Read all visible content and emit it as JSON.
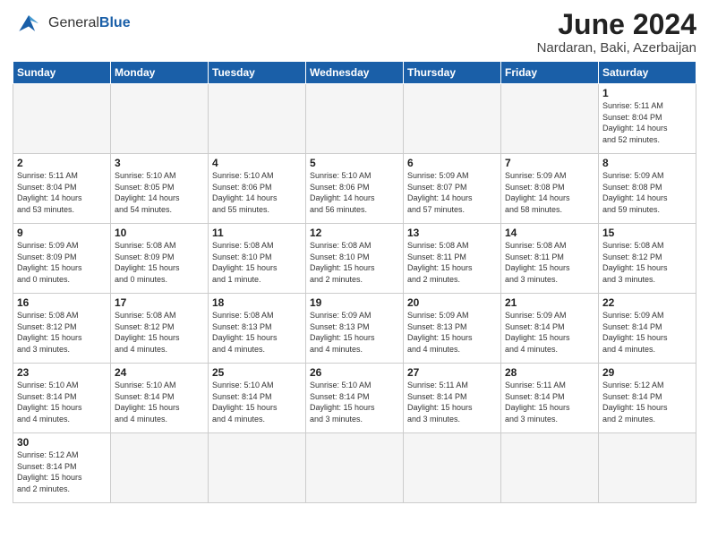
{
  "logo": {
    "general": "General",
    "blue": "Blue"
  },
  "header": {
    "title": "June 2024",
    "subtitle": "Nardaran, Baki, Azerbaijan"
  },
  "weekdays": [
    "Sunday",
    "Monday",
    "Tuesday",
    "Wednesday",
    "Thursday",
    "Friday",
    "Saturday"
  ],
  "days": [
    {
      "num": "",
      "info": "",
      "empty": true
    },
    {
      "num": "",
      "info": "",
      "empty": true
    },
    {
      "num": "",
      "info": "",
      "empty": true
    },
    {
      "num": "",
      "info": "",
      "empty": true
    },
    {
      "num": "",
      "info": "",
      "empty": true
    },
    {
      "num": "",
      "info": "",
      "empty": true
    },
    {
      "num": "1",
      "info": "Sunrise: 5:11 AM\nSunset: 8:04 PM\nDaylight: 14 hours\nand 52 minutes.",
      "empty": false
    },
    {
      "num": "2",
      "info": "Sunrise: 5:11 AM\nSunset: 8:04 PM\nDaylight: 14 hours\nand 53 minutes.",
      "empty": false
    },
    {
      "num": "3",
      "info": "Sunrise: 5:10 AM\nSunset: 8:05 PM\nDaylight: 14 hours\nand 54 minutes.",
      "empty": false
    },
    {
      "num": "4",
      "info": "Sunrise: 5:10 AM\nSunset: 8:06 PM\nDaylight: 14 hours\nand 55 minutes.",
      "empty": false
    },
    {
      "num": "5",
      "info": "Sunrise: 5:10 AM\nSunset: 8:06 PM\nDaylight: 14 hours\nand 56 minutes.",
      "empty": false
    },
    {
      "num": "6",
      "info": "Sunrise: 5:09 AM\nSunset: 8:07 PM\nDaylight: 14 hours\nand 57 minutes.",
      "empty": false
    },
    {
      "num": "7",
      "info": "Sunrise: 5:09 AM\nSunset: 8:08 PM\nDaylight: 14 hours\nand 58 minutes.",
      "empty": false
    },
    {
      "num": "8",
      "info": "Sunrise: 5:09 AM\nSunset: 8:08 PM\nDaylight: 14 hours\nand 59 minutes.",
      "empty": false
    },
    {
      "num": "9",
      "info": "Sunrise: 5:09 AM\nSunset: 8:09 PM\nDaylight: 15 hours\nand 0 minutes.",
      "empty": false
    },
    {
      "num": "10",
      "info": "Sunrise: 5:08 AM\nSunset: 8:09 PM\nDaylight: 15 hours\nand 0 minutes.",
      "empty": false
    },
    {
      "num": "11",
      "info": "Sunrise: 5:08 AM\nSunset: 8:10 PM\nDaylight: 15 hours\nand 1 minute.",
      "empty": false
    },
    {
      "num": "12",
      "info": "Sunrise: 5:08 AM\nSunset: 8:10 PM\nDaylight: 15 hours\nand 2 minutes.",
      "empty": false
    },
    {
      "num": "13",
      "info": "Sunrise: 5:08 AM\nSunset: 8:11 PM\nDaylight: 15 hours\nand 2 minutes.",
      "empty": false
    },
    {
      "num": "14",
      "info": "Sunrise: 5:08 AM\nSunset: 8:11 PM\nDaylight: 15 hours\nand 3 minutes.",
      "empty": false
    },
    {
      "num": "15",
      "info": "Sunrise: 5:08 AM\nSunset: 8:12 PM\nDaylight: 15 hours\nand 3 minutes.",
      "empty": false
    },
    {
      "num": "16",
      "info": "Sunrise: 5:08 AM\nSunset: 8:12 PM\nDaylight: 15 hours\nand 3 minutes.",
      "empty": false
    },
    {
      "num": "17",
      "info": "Sunrise: 5:08 AM\nSunset: 8:12 PM\nDaylight: 15 hours\nand 4 minutes.",
      "empty": false
    },
    {
      "num": "18",
      "info": "Sunrise: 5:08 AM\nSunset: 8:13 PM\nDaylight: 15 hours\nand 4 minutes.",
      "empty": false
    },
    {
      "num": "19",
      "info": "Sunrise: 5:09 AM\nSunset: 8:13 PM\nDaylight: 15 hours\nand 4 minutes.",
      "empty": false
    },
    {
      "num": "20",
      "info": "Sunrise: 5:09 AM\nSunset: 8:13 PM\nDaylight: 15 hours\nand 4 minutes.",
      "empty": false
    },
    {
      "num": "21",
      "info": "Sunrise: 5:09 AM\nSunset: 8:14 PM\nDaylight: 15 hours\nand 4 minutes.",
      "empty": false
    },
    {
      "num": "22",
      "info": "Sunrise: 5:09 AM\nSunset: 8:14 PM\nDaylight: 15 hours\nand 4 minutes.",
      "empty": false
    },
    {
      "num": "23",
      "info": "Sunrise: 5:10 AM\nSunset: 8:14 PM\nDaylight: 15 hours\nand 4 minutes.",
      "empty": false
    },
    {
      "num": "24",
      "info": "Sunrise: 5:10 AM\nSunset: 8:14 PM\nDaylight: 15 hours\nand 4 minutes.",
      "empty": false
    },
    {
      "num": "25",
      "info": "Sunrise: 5:10 AM\nSunset: 8:14 PM\nDaylight: 15 hours\nand 4 minutes.",
      "empty": false
    },
    {
      "num": "26",
      "info": "Sunrise: 5:10 AM\nSunset: 8:14 PM\nDaylight: 15 hours\nand 3 minutes.",
      "empty": false
    },
    {
      "num": "27",
      "info": "Sunrise: 5:11 AM\nSunset: 8:14 PM\nDaylight: 15 hours\nand 3 minutes.",
      "empty": false
    },
    {
      "num": "28",
      "info": "Sunrise: 5:11 AM\nSunset: 8:14 PM\nDaylight: 15 hours\nand 3 minutes.",
      "empty": false
    },
    {
      "num": "29",
      "info": "Sunrise: 5:12 AM\nSunset: 8:14 PM\nDaylight: 15 hours\nand 2 minutes.",
      "empty": false
    },
    {
      "num": "30",
      "info": "Sunrise: 5:12 AM\nSunset: 8:14 PM\nDaylight: 15 hours\nand 2 minutes.",
      "empty": false
    },
    {
      "num": "",
      "info": "",
      "empty": true
    },
    {
      "num": "",
      "info": "",
      "empty": true
    },
    {
      "num": "",
      "info": "",
      "empty": true
    },
    {
      "num": "",
      "info": "",
      "empty": true
    },
    {
      "num": "",
      "info": "",
      "empty": true
    },
    {
      "num": "",
      "info": "",
      "empty": true
    }
  ]
}
